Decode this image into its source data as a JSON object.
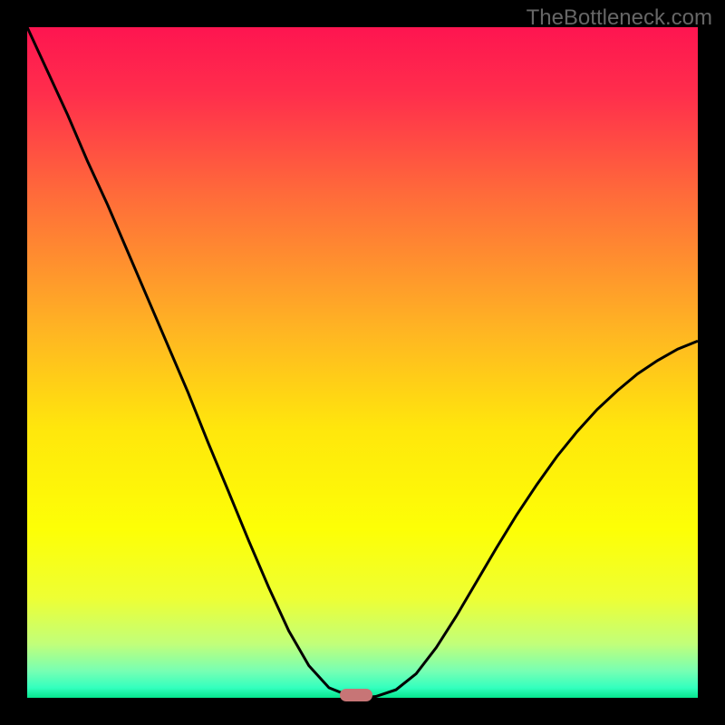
{
  "watermark": "TheBottleneck.com",
  "colors": {
    "black": "#000000",
    "marker": "#c77576",
    "curve": "#000000",
    "gradient_stops": [
      {
        "offset": 0.0,
        "color": "#fe1550"
      },
      {
        "offset": 0.1,
        "color": "#ff2e4c"
      },
      {
        "offset": 0.25,
        "color": "#ff6b3a"
      },
      {
        "offset": 0.45,
        "color": "#ffb423"
      },
      {
        "offset": 0.6,
        "color": "#ffe70c"
      },
      {
        "offset": 0.75,
        "color": "#fdff06"
      },
      {
        "offset": 0.85,
        "color": "#eeff33"
      },
      {
        "offset": 0.92,
        "color": "#c1ff7a"
      },
      {
        "offset": 0.96,
        "color": "#77ffb3"
      },
      {
        "offset": 0.985,
        "color": "#33ffbe"
      },
      {
        "offset": 1.0,
        "color": "#06e68e"
      }
    ]
  },
  "chart_data": {
    "type": "line",
    "title": "",
    "xlabel": "",
    "ylabel": "",
    "x": [
      0.0,
      0.03,
      0.06,
      0.09,
      0.12,
      0.15,
      0.18,
      0.21,
      0.24,
      0.27,
      0.3,
      0.33,
      0.36,
      0.39,
      0.42,
      0.45,
      0.48,
      0.5,
      0.52,
      0.55,
      0.58,
      0.61,
      0.64,
      0.67,
      0.7,
      0.73,
      0.76,
      0.79,
      0.82,
      0.85,
      0.88,
      0.91,
      0.94,
      0.97,
      1.0
    ],
    "y": [
      1.0,
      0.935,
      0.87,
      0.8,
      0.735,
      0.665,
      0.595,
      0.525,
      0.455,
      0.38,
      0.308,
      0.235,
      0.165,
      0.1,
      0.048,
      0.015,
      0.003,
      0.0,
      0.002,
      0.012,
      0.036,
      0.075,
      0.122,
      0.173,
      0.224,
      0.273,
      0.318,
      0.36,
      0.397,
      0.43,
      0.458,
      0.483,
      0.503,
      0.52,
      0.532
    ],
    "xlim": [
      0,
      1
    ],
    "ylim": [
      0,
      1
    ],
    "marker": {
      "x": 0.49,
      "y": 0.0,
      "color": "#c77576"
    }
  }
}
